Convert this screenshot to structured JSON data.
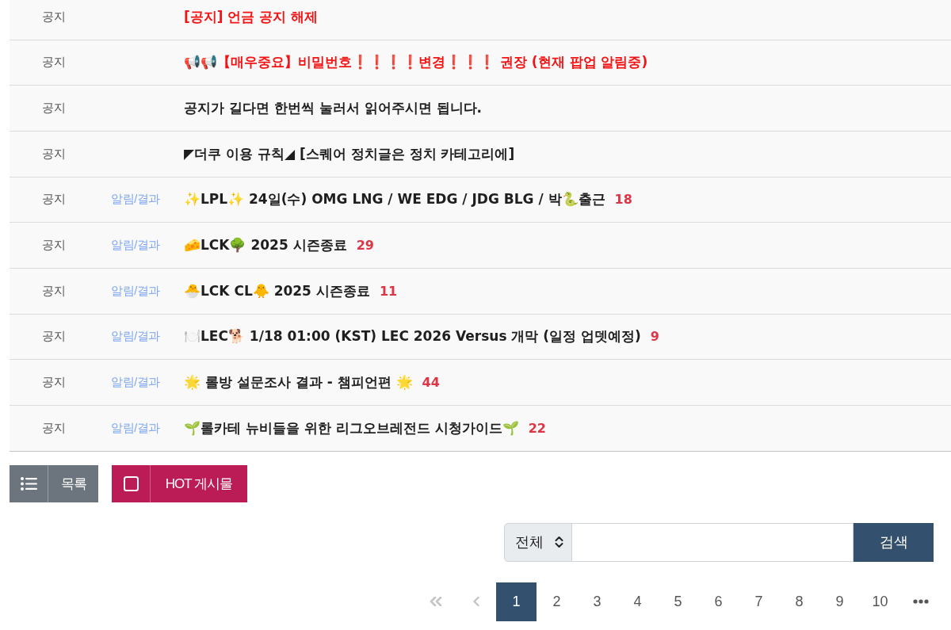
{
  "notices": [
    {
      "category": "공지",
      "title": "[공지] 언금 공지 해제",
      "important": true
    },
    {
      "category": "공지",
      "title": "📢📢【매우중요】비밀번호❗❗❗❗변경❗❗❗ 권장 (현재 팝업 알림중)",
      "important": true
    },
    {
      "category": "공지",
      "title": "공지가 길다면 한번씩 눌러서 읽어주시면 됩니다.",
      "important": false
    },
    {
      "category": "공지",
      "title": "◤더쿠 이용 규칙◢ [스퀘어 정치글은 정치 카테고리에]",
      "important": false
    },
    {
      "category": "공지",
      "tag": "알림/결과",
      "title": "✨LPL✨ 24일(수) OMG LNG / WE EDG / JDG BLG / 박🐍출근",
      "important": false,
      "comments": "18"
    },
    {
      "category": "공지",
      "tag": "알림/결과",
      "title": "🧀LCK🌳 2025 시즌종료",
      "important": false,
      "comments": "29"
    },
    {
      "category": "공지",
      "tag": "알림/결과",
      "title": "🐣LCK CL🐥 2025 시즌종료",
      "important": false,
      "comments": "11"
    },
    {
      "category": "공지",
      "tag": "알림/결과",
      "title": "🍽️LEC🐕 1/18 01:00 (KST) LEC 2026 Versus 개막 (일정 업뎃예정)",
      "important": false,
      "comments": "9"
    },
    {
      "category": "공지",
      "tag": "알림/결과",
      "title": "🌟 롤방 설문조사 결과 - 챔피언편 🌟",
      "important": false,
      "comments": "44"
    },
    {
      "category": "공지",
      "tag": "알림/결과",
      "title": "🌱롤카테 뉴비들을 위한 리그오브레전드 시청가이드🌱",
      "important": false,
      "comments": "22"
    }
  ],
  "buttons": [
    {
      "kind": "list",
      "label": "목록"
    },
    {
      "kind": "hot",
      "label": "HOT 게시물"
    }
  ],
  "search": {
    "scope": "전체",
    "button": "검색"
  },
  "pagination": {
    "before": [
      {
        "kind": "first",
        "disabled": true
      },
      {
        "kind": "previous",
        "disabled": true
      }
    ],
    "pages": [
      {
        "label": "1",
        "selected": true
      },
      {
        "label": "2",
        "selected": false
      },
      {
        "label": "3",
        "selected": false
      },
      {
        "label": "4",
        "selected": false
      },
      {
        "label": "5",
        "selected": false
      },
      {
        "label": "6",
        "selected": false
      },
      {
        "label": "7",
        "selected": false
      },
      {
        "label": "8",
        "selected": false
      },
      {
        "label": "9",
        "selected": false
      },
      {
        "label": "10",
        "selected": false
      }
    ],
    "after": [
      {
        "kind": "more",
        "disabled": false
      }
    ]
  }
}
